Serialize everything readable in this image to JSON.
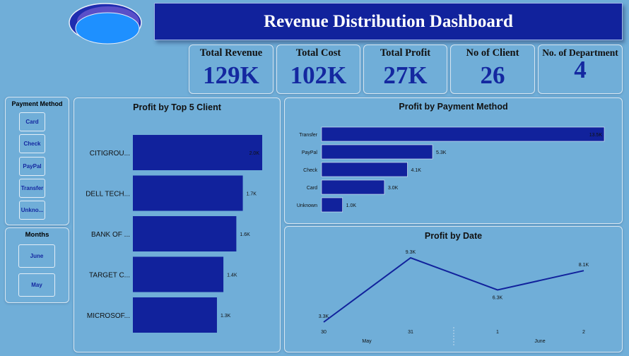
{
  "header": {
    "title": "Revenue Distribution Dashboard"
  },
  "colors": {
    "background": "#70aed8",
    "bar": "#11229c",
    "accent": "#1428a0",
    "logo_light": "#1e90ff",
    "logo_mid": "#5050c8"
  },
  "kpis": [
    {
      "label": "Total Revenue",
      "value": "129K"
    },
    {
      "label": "Total Cost",
      "value": "102K"
    },
    {
      "label": "Total Profit",
      "value": "27K"
    },
    {
      "label": "No of Client",
      "value": "26"
    },
    {
      "label": "No. of Department",
      "value": "4"
    }
  ],
  "slicers": {
    "payment_method": {
      "title": "Payment Method",
      "options": [
        "Card",
        "Check",
        "PayPal",
        "Transfer",
        "Unkno..."
      ]
    },
    "months": {
      "title": "Months",
      "options": [
        "June",
        "May"
      ]
    }
  },
  "chart_data": [
    {
      "type": "bar",
      "orientation": "horizontal",
      "title": "Profit by Top 5 Client",
      "categories": [
        "CITIGROU...",
        "DELL TECH...",
        "BANK OF ...",
        "TARGET C...",
        "MICROSOF..."
      ],
      "values": [
        2.0,
        1.7,
        1.6,
        1.4,
        1.3
      ],
      "value_labels": [
        "2.0K",
        "1.7K",
        "1.6K",
        "1.4K",
        "1.3K"
      ],
      "unit": "K"
    },
    {
      "type": "bar",
      "orientation": "horizontal",
      "title": "Profit by Payment Method",
      "categories": [
        "Transfer",
        "PayPal",
        "Check",
        "Card",
        "Unknown"
      ],
      "values": [
        13.5,
        5.3,
        4.1,
        3.0,
        1.0
      ],
      "value_labels": [
        "13.5K",
        "5.3K",
        "4.1K",
        "3.0K",
        "1.0K"
      ],
      "unit": "K"
    },
    {
      "type": "line",
      "title": "Profit by Date",
      "x": [
        "30",
        "31",
        "1",
        "2"
      ],
      "x_groups": [
        {
          "label": "May",
          "ticks": [
            "30",
            "31"
          ]
        },
        {
          "label": "June",
          "ticks": [
            "1",
            "2"
          ]
        }
      ],
      "values": [
        3.3,
        9.3,
        6.3,
        8.1
      ],
      "value_labels": [
        "3.3K",
        "9.3K",
        "6.3K",
        "8.1K"
      ],
      "unit": "K"
    }
  ]
}
